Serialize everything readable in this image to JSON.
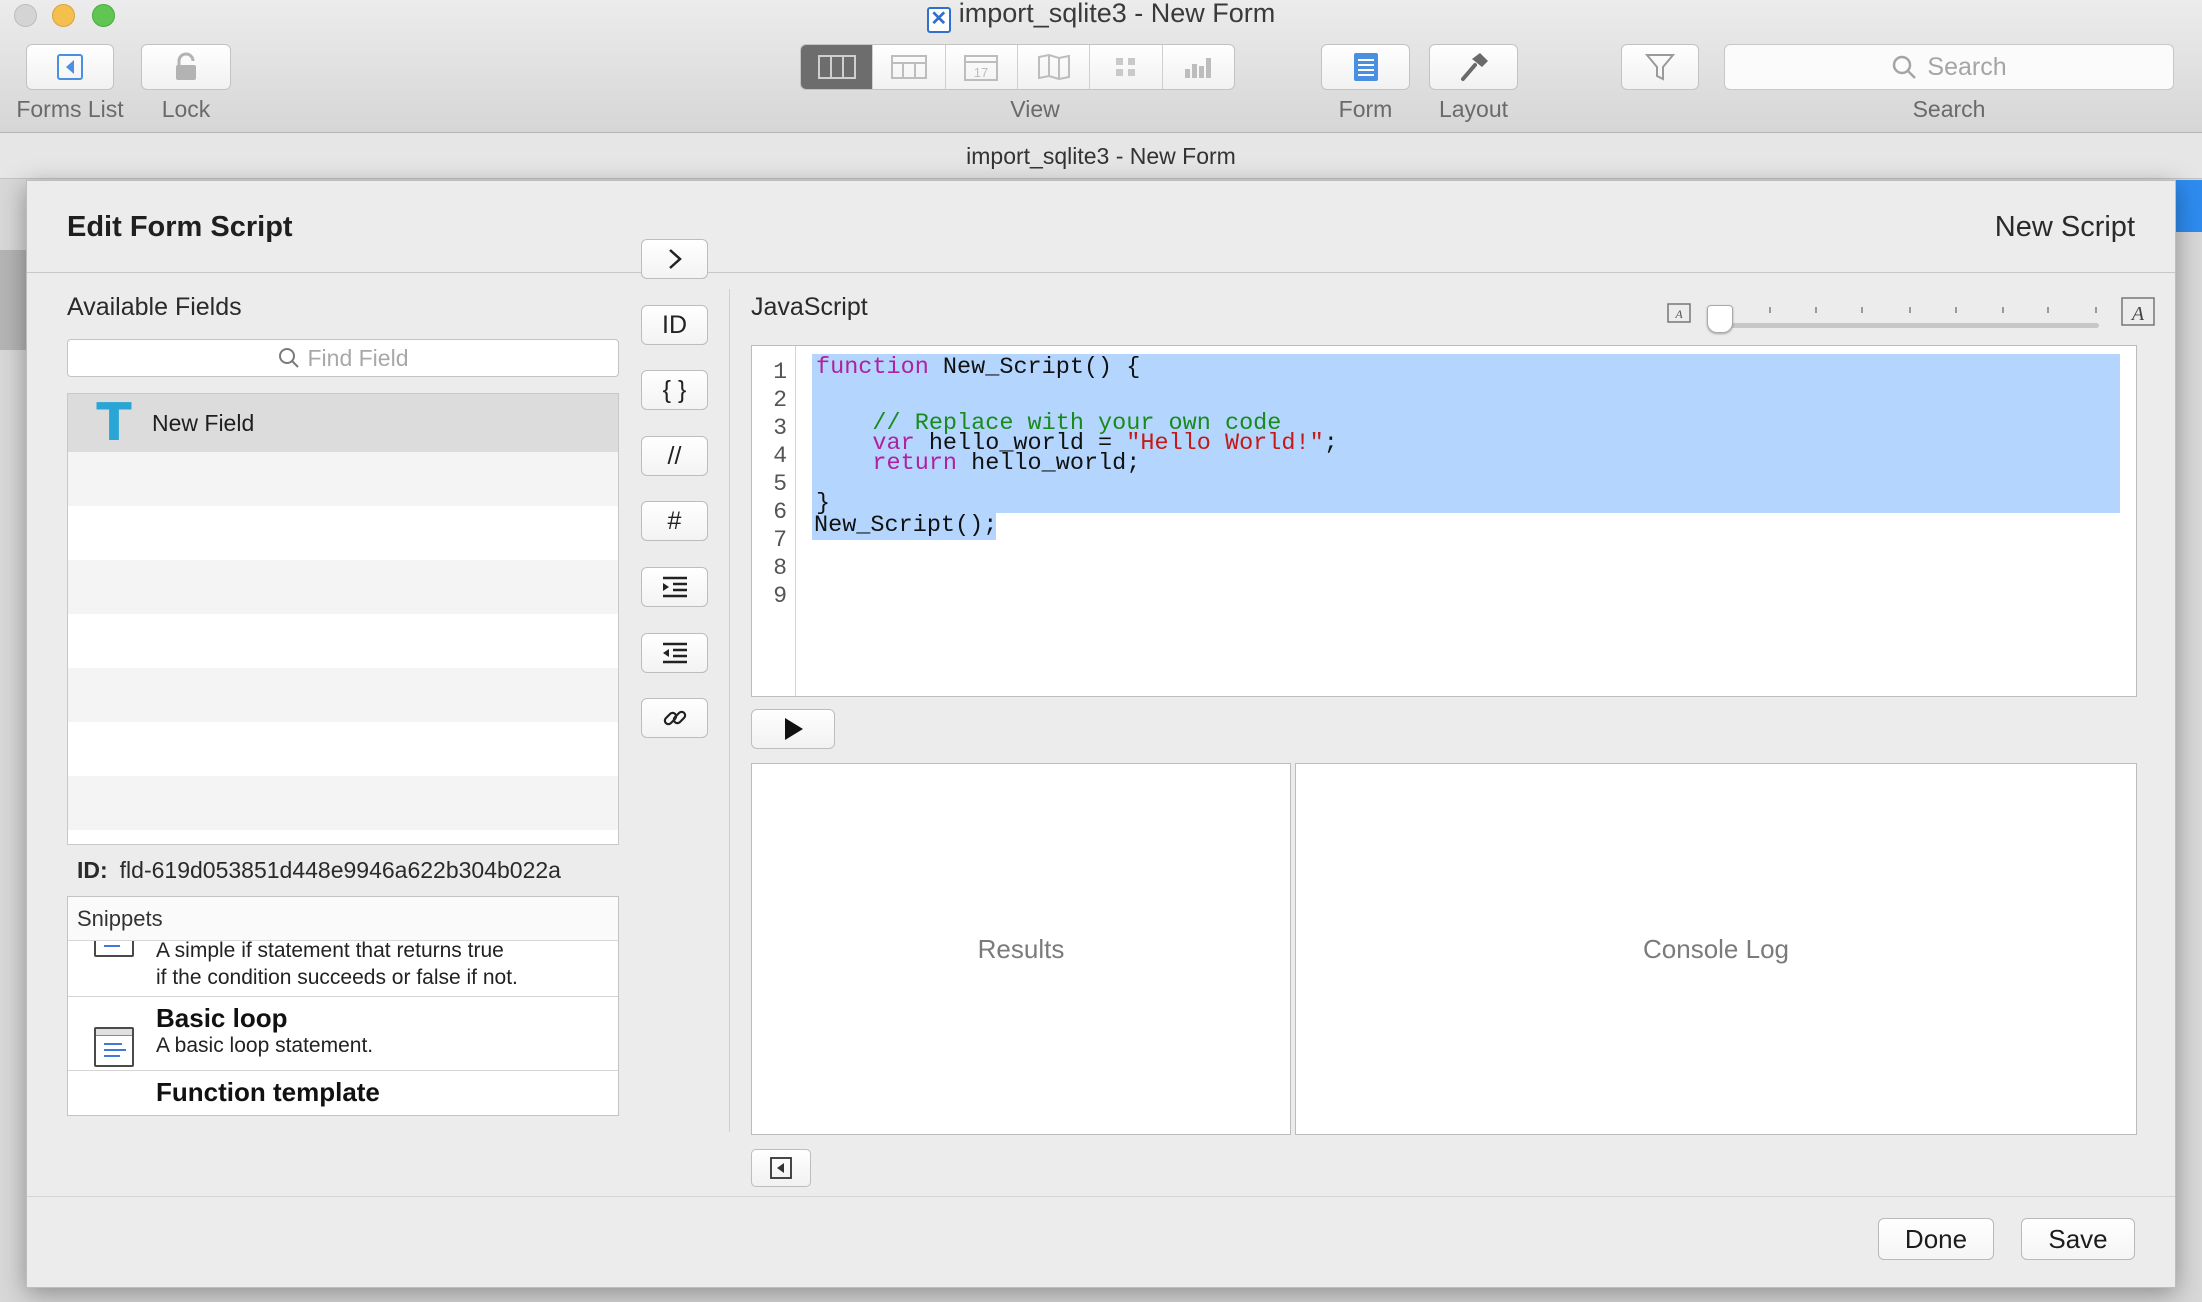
{
  "window": {
    "title": "import_sqlite3 - New Form",
    "doc_icon": "✕",
    "subtitle": "import_sqlite3 - New Form"
  },
  "toolbar": {
    "forms_list_label": "Forms List",
    "lock_label": "Lock",
    "view_label": "View",
    "form_label": "Form",
    "layout_label": "Layout",
    "search_label": "Search",
    "search_placeholder": "Search",
    "view_modes": [
      "table-view",
      "grid-view",
      "calendar-view",
      "map-view",
      "cards-view",
      "chart-view"
    ],
    "view_selected": "table-view",
    "calendar_day": "17"
  },
  "dialog": {
    "title": "Edit Form Script",
    "script_name": "New Script",
    "available_fields_label": "Available Fields",
    "find_field_placeholder": "Find Field",
    "fields": [
      {
        "name": "New Field",
        "type": "text-field-icon",
        "selected": true
      }
    ],
    "id_label": "ID:",
    "id_value": "fld-619d053851d448e9946a622b304b022a",
    "snippets_label": "Snippets",
    "snippets": [
      {
        "title": "",
        "description_line1": "A simple if statement that returns true",
        "description_line2": "if the condition succeeds or false if not."
      },
      {
        "title": "Basic loop",
        "description_line1": "A basic loop statement.",
        "description_line2": ""
      },
      {
        "title": "Function template",
        "description_line1": "",
        "description_line2": ""
      }
    ],
    "tools": {
      "insert": "›",
      "id": "ID",
      "braces": "{ }",
      "comment": "//",
      "hash": "#"
    },
    "language_label": "JavaScript",
    "code": {
      "line_numbers": [
        "1",
        "2",
        "3",
        "4",
        "5",
        "6",
        "7",
        "8",
        "9"
      ],
      "l1_kw": "function",
      "l1_rest": " New_Script() {",
      "l3_comment": "    // Replace with your own code",
      "l4_kw": "    var",
      "l4_mid": " hello_world = ",
      "l4_str": "\"Hello World!\"",
      "l4_end": ";",
      "l5_kw": "    return",
      "l5_rest": " hello_world;",
      "l7": "}",
      "l9": "New_Script();"
    },
    "results_label": "Results",
    "console_label": "Console Log",
    "done_label": "Done",
    "save_label": "Save"
  },
  "colors": {
    "selection": "#b4d6fe",
    "keyword": "#b0209f",
    "comment": "#198a1c",
    "string": "#c41a16",
    "text_field_icon": "#29a6d6"
  }
}
